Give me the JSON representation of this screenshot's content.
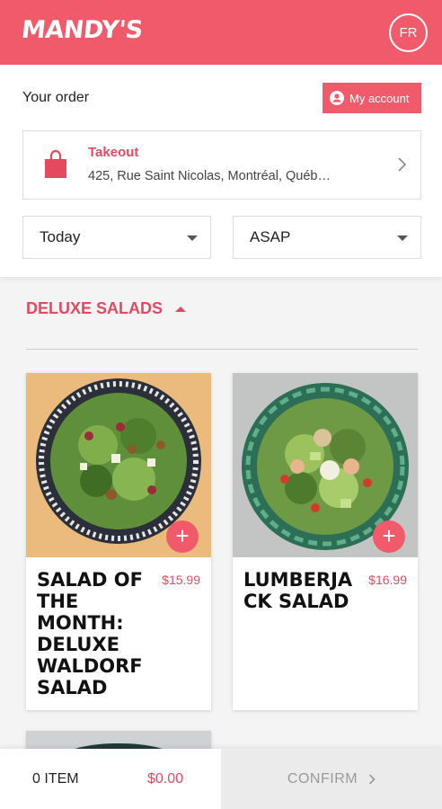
{
  "header": {
    "logo": "MANDY'S",
    "lang_label": "FR",
    "brand_color": "#f15a6a"
  },
  "order": {
    "title": "Your order",
    "account_label": "My account",
    "mode_label": "Takeout",
    "address": "425, Rue Saint Nicolas, Montréal, Québ…",
    "day_value": "Today",
    "time_value": "ASAP"
  },
  "menu": {
    "section_title": "DELUXE SALADS",
    "items": [
      {
        "name": "SALAD OF THE MONTH: DELUXE WALDORF SALAD",
        "price": "$15.99",
        "add_label": "+"
      },
      {
        "name": "LUMBERJA CK SALAD",
        "price": "$16.99",
        "add_label": "+"
      }
    ]
  },
  "cart": {
    "items_label": "0 ITEM",
    "total": "$0.00",
    "confirm_label": "CONFIRM"
  }
}
